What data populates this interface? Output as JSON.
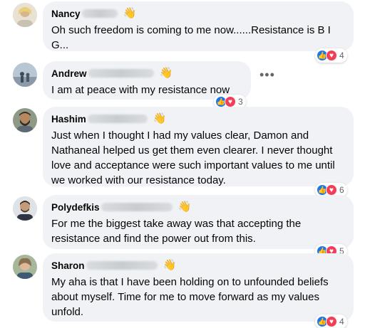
{
  "comments": [
    {
      "name": "Nancy",
      "text": "Oh such freedom is coming to me now......Resistance is B I G...",
      "reaction_count": "4"
    },
    {
      "name": "Andrew",
      "text": "I am at peace with my resistance now",
      "reaction_count": "3"
    },
    {
      "name": "Hashim",
      "text": "Just when I thought I had my values clear, Damon and Nathaneal helped us get them even clearer. I never thought love and acceptance were such important values to me until we worked with our resistance today.",
      "reaction_count": "6"
    },
    {
      "name": "Polydefkis",
      "text": "For me the biggest take away was that accepting the resistance and find the power out from this.",
      "reaction_count": "5"
    },
    {
      "name": "Sharon",
      "text": "My aha is that I have been holding on to unfounded beliefs about myself. Time for me to move forward as my values unfold.",
      "reaction_count": "4"
    }
  ],
  "icons": {
    "wave": "wave-icon",
    "like": "like-reaction-icon",
    "love": "love-reaction-icon",
    "more": "more-options-icon"
  },
  "colors": {
    "bubble": "#f0f2f5",
    "like": "#1877f2",
    "love": "#f33e58"
  }
}
